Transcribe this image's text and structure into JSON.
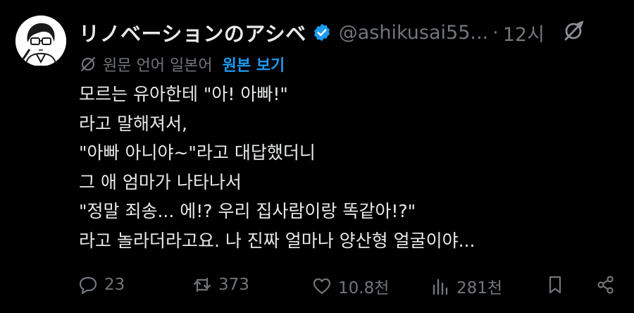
{
  "tweet": {
    "author": {
      "display_name": "リノベーションのアシベ",
      "handle": "@ashikusai55...",
      "verified": true,
      "verified_color": "#1d9bf0"
    },
    "time": "12시",
    "translation": {
      "note": "원문 언어 일본어",
      "show_original_label": "원본 보기"
    },
    "body_lines": [
      "모르는 유아한테 \"아! 아빠!\"",
      "라고 말해져서,",
      "\"아빠 아니야~\"라고 대답했더니",
      "그 애 엄마가 나타나서",
      "\"정말 죄송... 에!? 우리 집사람이랑 똑같아!?\"",
      "라고 놀라더라고요. 나 진짜 얼마나 양산형 얼굴이야..."
    ],
    "actions": {
      "reply_count": "23",
      "retweet_count": "373",
      "like_count": "10.8천",
      "view_count": "281천"
    },
    "icons": {
      "header_action": "grok-slash-icon",
      "translate": "grok-slash-icon",
      "reply": "reply-bubble-icon",
      "retweet": "retweet-icon",
      "like": "heart-icon",
      "views": "bar-chart-icon",
      "bookmark": "bookmark-icon",
      "share": "share-icon"
    }
  }
}
